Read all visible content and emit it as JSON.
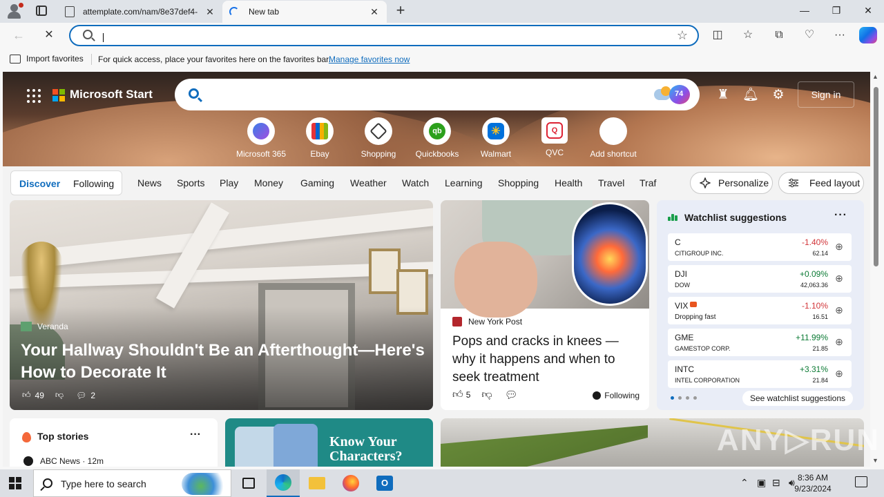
{
  "browser": {
    "tabs": [
      {
        "title": "attemplate.com/nam/8e37def4-",
        "close": "✕"
      },
      {
        "title": "New tab",
        "close": "✕"
      }
    ],
    "new_tab": "+",
    "window_controls": {
      "minimize": "—",
      "restore": "❐",
      "close": "✕"
    },
    "address_bar": {
      "value": "",
      "placeholder": ""
    },
    "favorites_bar": {
      "import_label": "Import favorites",
      "message": "For quick access, place your favorites here on the favorites bar.",
      "manage_link": "Manage favorites now"
    }
  },
  "page": {
    "brand": "Microsoft Start",
    "weather_badge": "74",
    "sign_in": "Sign in",
    "shortcuts": [
      {
        "label": "Microsoft 365",
        "icon": "microsoft-365-icon"
      },
      {
        "label": "Ebay",
        "icon": "ebay-icon"
      },
      {
        "label": "Shopping",
        "icon": "shopping-tag-icon"
      },
      {
        "label": "Quickbooks",
        "icon": "quickbooks-icon"
      },
      {
        "label": "Walmart",
        "icon": "walmart-icon"
      },
      {
        "label": "QVC",
        "icon": "qvc-icon"
      },
      {
        "label": "Add shortcut",
        "icon": "plus-icon"
      }
    ],
    "feed_tabs": {
      "discover": "Discover",
      "following": "Following"
    },
    "categories": [
      "News",
      "Sports",
      "Play",
      "Money",
      "Gaming",
      "Weather",
      "Watch",
      "Learning",
      "Shopping",
      "Health",
      "Travel",
      "Traf"
    ],
    "personalize": "Personalize",
    "feed_layout": "Feed layout",
    "hero_card": {
      "source": "Veranda",
      "headline": "Your Hallway Shouldn't Be an Afterthought—Here's How to Decorate It",
      "likes": "49",
      "comments": "2"
    },
    "knee_card": {
      "source": "New York Post",
      "headline": "Pops and cracks in knees — why it happens and when to seek treatment",
      "likes": "5",
      "following": "Following"
    },
    "watchlist": {
      "title": "Watchlist suggestions",
      "more": "···",
      "stocks": [
        {
          "symbol": "C",
          "name": "CITIGROUP INC.",
          "change": "-1.40%",
          "price": "62.14",
          "direction": "neg"
        },
        {
          "symbol": "DJI",
          "name": "DOW",
          "change": "+0.09%",
          "price": "42,063.36",
          "direction": "pos"
        },
        {
          "symbol": "VIX",
          "name": "Dropping fast",
          "change": "-1.10%",
          "price": "16.51",
          "direction": "neg"
        },
        {
          "symbol": "GME",
          "name": "GAMESTOP CORP.",
          "change": "+11.99%",
          "price": "21.85",
          "direction": "pos"
        },
        {
          "symbol": "INTC",
          "name": "INTEL CORPORATION",
          "change": "+3.31%",
          "price": "21.84",
          "direction": "pos"
        }
      ],
      "see_all": "See watchlist suggestions"
    },
    "top_stories": {
      "title": "Top stories",
      "first_source": "ABC News · 12m",
      "more": "···"
    },
    "game_card": {
      "line1": "Know Your",
      "line2": "Characters?"
    },
    "watermark": "ANY▷RUN"
  },
  "taskbar": {
    "search_placeholder": "Type here to search",
    "time": "8:36 AM",
    "date": "9/23/2024"
  },
  "colors": {
    "accent": "#0f6cbd",
    "negative": "#d13438",
    "positive": "#0b7a34"
  }
}
